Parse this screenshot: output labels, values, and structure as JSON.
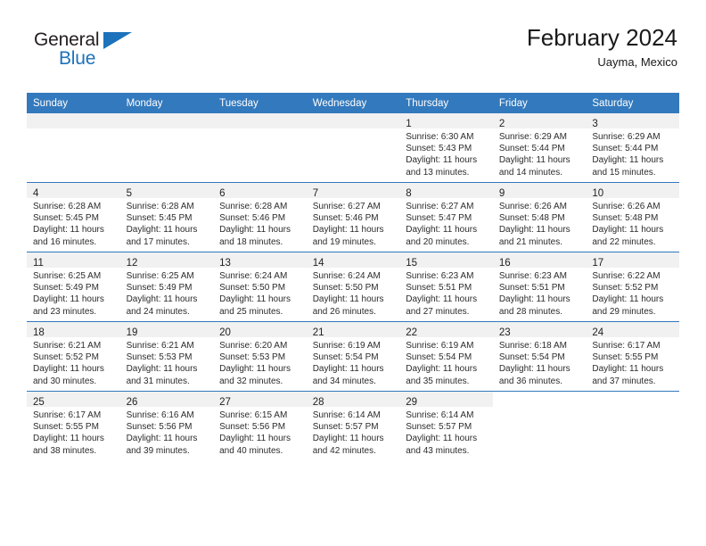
{
  "brand": {
    "name_part1": "General",
    "name_part2": "Blue",
    "accent_color": "#1c72bb"
  },
  "header": {
    "title": "February 2024",
    "subtitle": "Uayma, Mexico"
  },
  "calendar": {
    "header_color": "#3379bd",
    "weekdays": [
      "Sunday",
      "Monday",
      "Tuesday",
      "Wednesday",
      "Thursday",
      "Friday",
      "Saturday"
    ],
    "weeks": [
      [
        {
          "day": "",
          "empty": true
        },
        {
          "day": "",
          "empty": true
        },
        {
          "day": "",
          "empty": true
        },
        {
          "day": "",
          "empty": true
        },
        {
          "day": "1",
          "sunrise": "Sunrise: 6:30 AM",
          "sunset": "Sunset: 5:43 PM",
          "daylight1": "Daylight: 11 hours",
          "daylight2": "and 13 minutes."
        },
        {
          "day": "2",
          "sunrise": "Sunrise: 6:29 AM",
          "sunset": "Sunset: 5:44 PM",
          "daylight1": "Daylight: 11 hours",
          "daylight2": "and 14 minutes."
        },
        {
          "day": "3",
          "sunrise": "Sunrise: 6:29 AM",
          "sunset": "Sunset: 5:44 PM",
          "daylight1": "Daylight: 11 hours",
          "daylight2": "and 15 minutes."
        }
      ],
      [
        {
          "day": "4",
          "sunrise": "Sunrise: 6:28 AM",
          "sunset": "Sunset: 5:45 PM",
          "daylight1": "Daylight: 11 hours",
          "daylight2": "and 16 minutes."
        },
        {
          "day": "5",
          "sunrise": "Sunrise: 6:28 AM",
          "sunset": "Sunset: 5:45 PM",
          "daylight1": "Daylight: 11 hours",
          "daylight2": "and 17 minutes."
        },
        {
          "day": "6",
          "sunrise": "Sunrise: 6:28 AM",
          "sunset": "Sunset: 5:46 PM",
          "daylight1": "Daylight: 11 hours",
          "daylight2": "and 18 minutes."
        },
        {
          "day": "7",
          "sunrise": "Sunrise: 6:27 AM",
          "sunset": "Sunset: 5:46 PM",
          "daylight1": "Daylight: 11 hours",
          "daylight2": "and 19 minutes."
        },
        {
          "day": "8",
          "sunrise": "Sunrise: 6:27 AM",
          "sunset": "Sunset: 5:47 PM",
          "daylight1": "Daylight: 11 hours",
          "daylight2": "and 20 minutes."
        },
        {
          "day": "9",
          "sunrise": "Sunrise: 6:26 AM",
          "sunset": "Sunset: 5:48 PM",
          "daylight1": "Daylight: 11 hours",
          "daylight2": "and 21 minutes."
        },
        {
          "day": "10",
          "sunrise": "Sunrise: 6:26 AM",
          "sunset": "Sunset: 5:48 PM",
          "daylight1": "Daylight: 11 hours",
          "daylight2": "and 22 minutes."
        }
      ],
      [
        {
          "day": "11",
          "sunrise": "Sunrise: 6:25 AM",
          "sunset": "Sunset: 5:49 PM",
          "daylight1": "Daylight: 11 hours",
          "daylight2": "and 23 minutes."
        },
        {
          "day": "12",
          "sunrise": "Sunrise: 6:25 AM",
          "sunset": "Sunset: 5:49 PM",
          "daylight1": "Daylight: 11 hours",
          "daylight2": "and 24 minutes."
        },
        {
          "day": "13",
          "sunrise": "Sunrise: 6:24 AM",
          "sunset": "Sunset: 5:50 PM",
          "daylight1": "Daylight: 11 hours",
          "daylight2": "and 25 minutes."
        },
        {
          "day": "14",
          "sunrise": "Sunrise: 6:24 AM",
          "sunset": "Sunset: 5:50 PM",
          "daylight1": "Daylight: 11 hours",
          "daylight2": "and 26 minutes."
        },
        {
          "day": "15",
          "sunrise": "Sunrise: 6:23 AM",
          "sunset": "Sunset: 5:51 PM",
          "daylight1": "Daylight: 11 hours",
          "daylight2": "and 27 minutes."
        },
        {
          "day": "16",
          "sunrise": "Sunrise: 6:23 AM",
          "sunset": "Sunset: 5:51 PM",
          "daylight1": "Daylight: 11 hours",
          "daylight2": "and 28 minutes."
        },
        {
          "day": "17",
          "sunrise": "Sunrise: 6:22 AM",
          "sunset": "Sunset: 5:52 PM",
          "daylight1": "Daylight: 11 hours",
          "daylight2": "and 29 minutes."
        }
      ],
      [
        {
          "day": "18",
          "sunrise": "Sunrise: 6:21 AM",
          "sunset": "Sunset: 5:52 PM",
          "daylight1": "Daylight: 11 hours",
          "daylight2": "and 30 minutes."
        },
        {
          "day": "19",
          "sunrise": "Sunrise: 6:21 AM",
          "sunset": "Sunset: 5:53 PM",
          "daylight1": "Daylight: 11 hours",
          "daylight2": "and 31 minutes."
        },
        {
          "day": "20",
          "sunrise": "Sunrise: 6:20 AM",
          "sunset": "Sunset: 5:53 PM",
          "daylight1": "Daylight: 11 hours",
          "daylight2": "and 32 minutes."
        },
        {
          "day": "21",
          "sunrise": "Sunrise: 6:19 AM",
          "sunset": "Sunset: 5:54 PM",
          "daylight1": "Daylight: 11 hours",
          "daylight2": "and 34 minutes."
        },
        {
          "day": "22",
          "sunrise": "Sunrise: 6:19 AM",
          "sunset": "Sunset: 5:54 PM",
          "daylight1": "Daylight: 11 hours",
          "daylight2": "and 35 minutes."
        },
        {
          "day": "23",
          "sunrise": "Sunrise: 6:18 AM",
          "sunset": "Sunset: 5:54 PM",
          "daylight1": "Daylight: 11 hours",
          "daylight2": "and 36 minutes."
        },
        {
          "day": "24",
          "sunrise": "Sunrise: 6:17 AM",
          "sunset": "Sunset: 5:55 PM",
          "daylight1": "Daylight: 11 hours",
          "daylight2": "and 37 minutes."
        }
      ],
      [
        {
          "day": "25",
          "sunrise": "Sunrise: 6:17 AM",
          "sunset": "Sunset: 5:55 PM",
          "daylight1": "Daylight: 11 hours",
          "daylight2": "and 38 minutes."
        },
        {
          "day": "26",
          "sunrise": "Sunrise: 6:16 AM",
          "sunset": "Sunset: 5:56 PM",
          "daylight1": "Daylight: 11 hours",
          "daylight2": "and 39 minutes."
        },
        {
          "day": "27",
          "sunrise": "Sunrise: 6:15 AM",
          "sunset": "Sunset: 5:56 PM",
          "daylight1": "Daylight: 11 hours",
          "daylight2": "and 40 minutes."
        },
        {
          "day": "28",
          "sunrise": "Sunrise: 6:14 AM",
          "sunset": "Sunset: 5:57 PM",
          "daylight1": "Daylight: 11 hours",
          "daylight2": "and 42 minutes."
        },
        {
          "day": "29",
          "sunrise": "Sunrise: 6:14 AM",
          "sunset": "Sunset: 5:57 PM",
          "daylight1": "Daylight: 11 hours",
          "daylight2": "and 43 minutes."
        },
        {
          "day": "",
          "empty": true,
          "no_band": true
        },
        {
          "day": "",
          "empty": true,
          "no_band": true
        }
      ]
    ]
  }
}
